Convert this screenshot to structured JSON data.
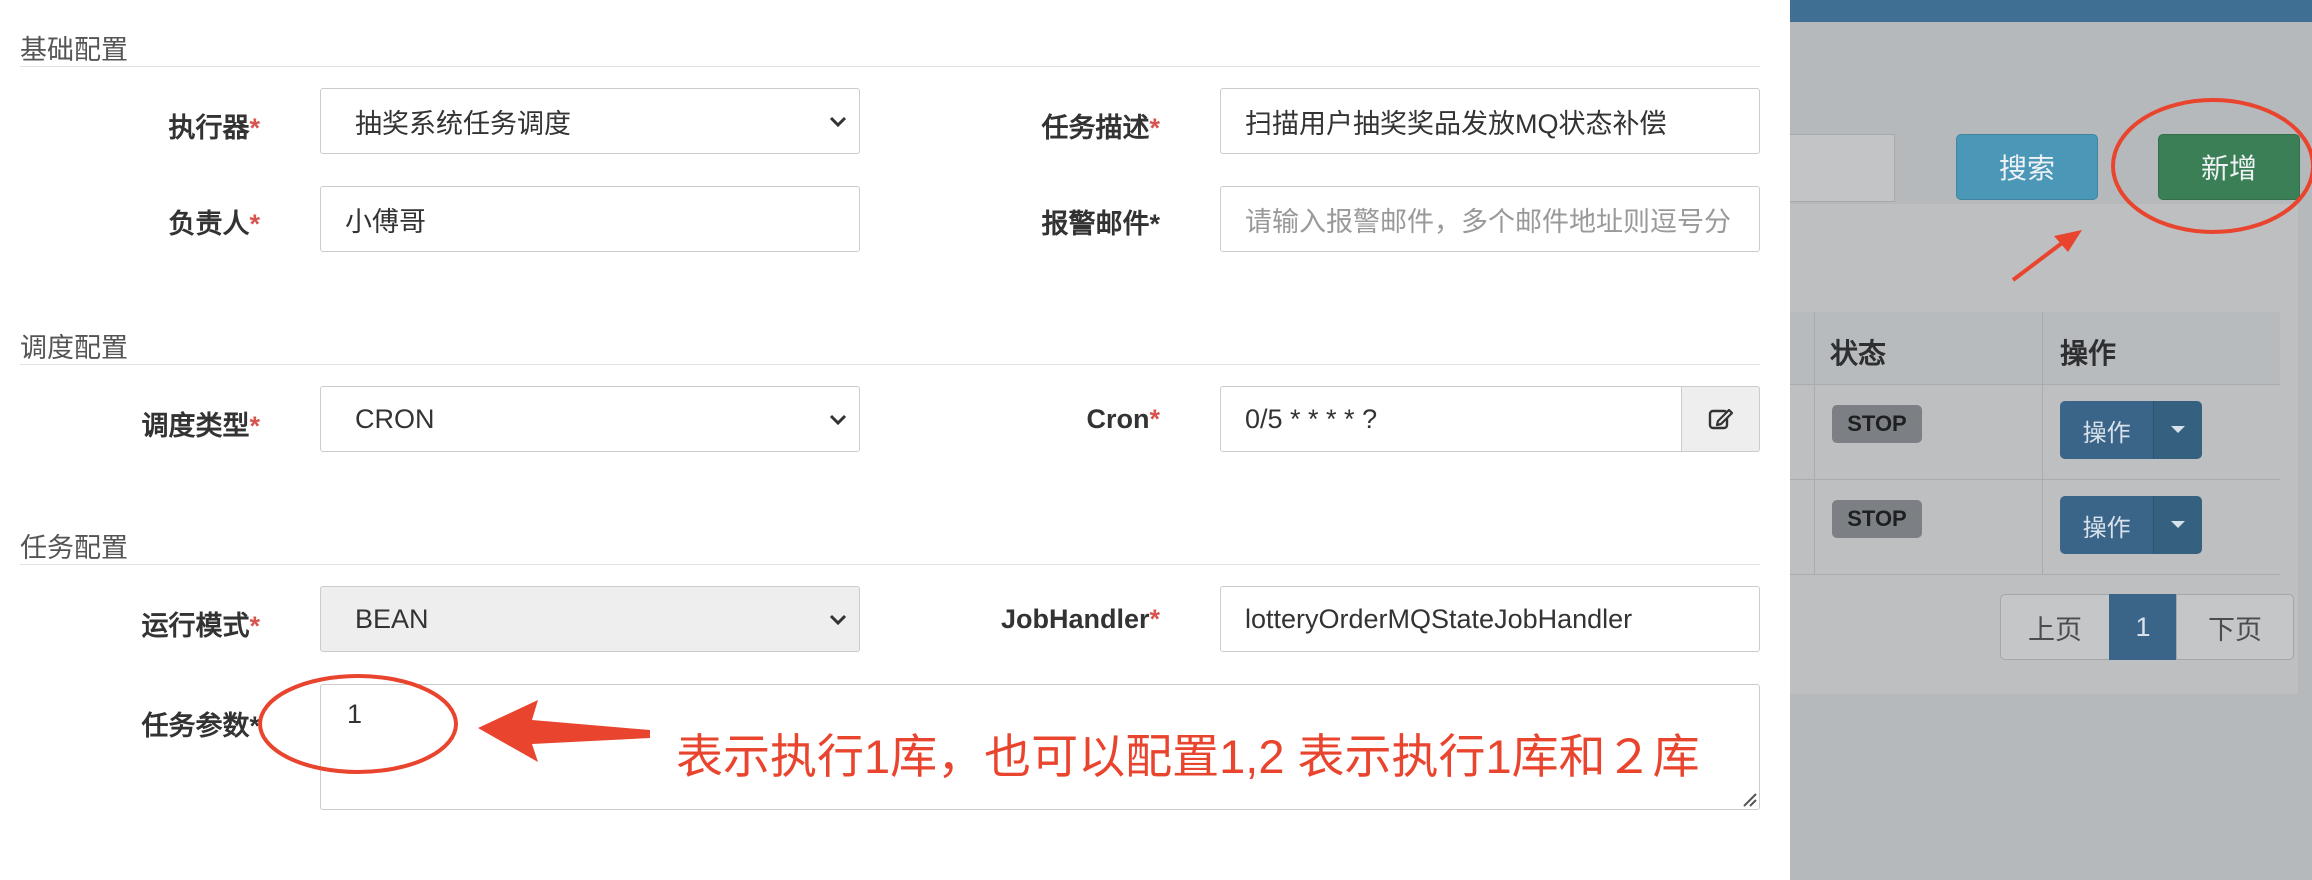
{
  "sections": {
    "basic": "基础配置",
    "schedule": "调度配置",
    "task": "任务配置"
  },
  "form": {
    "executor_label": "执行器",
    "executor_value": "抽奖系统任务调度",
    "job_desc_label": "任务描述",
    "job_desc_value": "扫描用户抽奖奖品发放MQ状态补偿",
    "author_label": "负责人",
    "author_value": "小傅哥",
    "alarm_email_label": "报警邮件",
    "alarm_email_placeholder": "请输入报警邮件，多个邮件地址则逗号分",
    "schedule_type_label": "调度类型",
    "schedule_type_value": "CRON",
    "cron_label": "Cron",
    "cron_value": "0/5 * * * * ?",
    "run_mode_label": "运行模式",
    "run_mode_value": "BEAN",
    "job_handler_label": "JobHandler",
    "job_handler_value": "lotteryOrderMQStateJobHandler",
    "job_param_label": "任务参数",
    "job_param_value": "1",
    "required_mark": "*"
  },
  "annotation": {
    "text": "表示执行1库，也可以配置1,2 表示执行1库和２库",
    "color": "#e9442e"
  },
  "background_page": {
    "search_button": "搜索",
    "add_button": "新增",
    "table_headers": [
      "状态",
      "操作"
    ],
    "rows": [
      {
        "status": "STOP",
        "action": "操作"
      },
      {
        "status": "STOP",
        "action": "操作"
      }
    ],
    "pagination": {
      "prev": "上页",
      "current": "1",
      "next": "下页"
    }
  }
}
